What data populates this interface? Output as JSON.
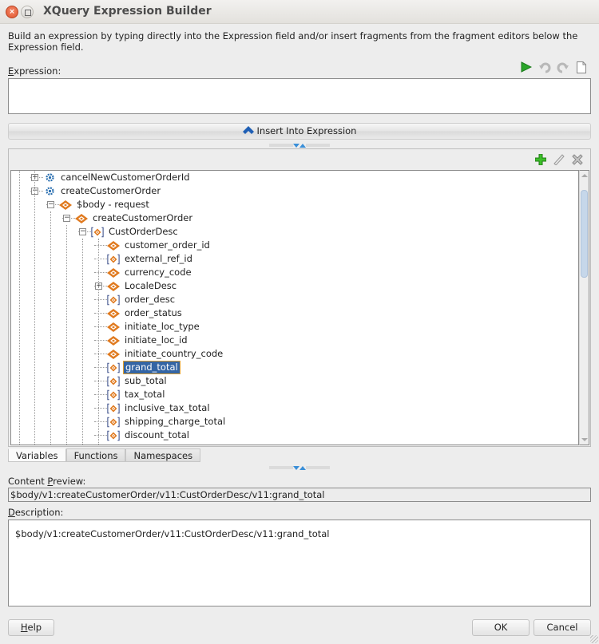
{
  "window": {
    "title": "XQuery Expression Builder"
  },
  "intro_text": "Build an expression by typing directly into the Expression field and/or insert fragments from the fragment editors below the Expression field.",
  "expression": {
    "label_mnemonic": "E",
    "label_rest": "xpression:",
    "value": "",
    "toolbar": [
      {
        "name": "run-icon",
        "color": "#2aa52a"
      },
      {
        "name": "undo-icon"
      },
      {
        "name": "redo-icon"
      },
      {
        "name": "new-document-icon"
      }
    ]
  },
  "insert_button": {
    "label": "Insert Into Expression",
    "icon": "chevron-up-icon",
    "icon_color": "#1f5fb5"
  },
  "tree_toolbar": {
    "add": "add-icon",
    "edit": "edit-icon",
    "delete": "delete-icon"
  },
  "tree": {
    "selected": "grand_total",
    "nodes": [
      {
        "label": "cancelNewCustomerOrderId",
        "icon": "operation-icon",
        "depth": 0,
        "expander": "+"
      },
      {
        "label": "createCustomerOrder",
        "icon": "operation-icon",
        "depth": 0,
        "expander": "-"
      },
      {
        "label": "$body - request",
        "icon": "element-icon",
        "depth": 1,
        "expander": "-"
      },
      {
        "label": "createCustomerOrder",
        "icon": "element-icon",
        "depth": 2,
        "expander": "-"
      },
      {
        "label": "CustOrderDesc",
        "icon": "repeating-element-icon",
        "depth": 3,
        "expander": "-"
      },
      {
        "label": "customer_order_id",
        "icon": "element-icon",
        "depth": 4,
        "expander": ""
      },
      {
        "label": "external_ref_id",
        "icon": "repeating-element-icon",
        "depth": 4,
        "expander": ""
      },
      {
        "label": "currency_code",
        "icon": "element-icon",
        "depth": 4,
        "expander": ""
      },
      {
        "label": "LocaleDesc",
        "icon": "element-icon",
        "depth": 4,
        "expander": "+"
      },
      {
        "label": "order_desc",
        "icon": "repeating-element-icon",
        "depth": 4,
        "expander": ""
      },
      {
        "label": "order_status",
        "icon": "element-icon",
        "depth": 4,
        "expander": ""
      },
      {
        "label": "initiate_loc_type",
        "icon": "element-icon",
        "depth": 4,
        "expander": ""
      },
      {
        "label": "initiate_loc_id",
        "icon": "element-icon",
        "depth": 4,
        "expander": ""
      },
      {
        "label": "initiate_country_code",
        "icon": "element-icon",
        "depth": 4,
        "expander": ""
      },
      {
        "label": "grand_total",
        "icon": "repeating-element-icon",
        "depth": 4,
        "expander": ""
      },
      {
        "label": "sub_total",
        "icon": "repeating-element-icon",
        "depth": 4,
        "expander": ""
      },
      {
        "label": "tax_total",
        "icon": "repeating-element-icon",
        "depth": 4,
        "expander": ""
      },
      {
        "label": "inclusive_tax_total",
        "icon": "repeating-element-icon",
        "depth": 4,
        "expander": ""
      },
      {
        "label": "shipping_charge_total",
        "icon": "repeating-element-icon",
        "depth": 4,
        "expander": ""
      },
      {
        "label": "discount_total",
        "icon": "repeating-element-icon",
        "depth": 4,
        "expander": ""
      }
    ]
  },
  "tabs": [
    {
      "label": "Variables",
      "active": true
    },
    {
      "label": "Functions",
      "active": false
    },
    {
      "label": "Namespaces",
      "active": false
    }
  ],
  "content_preview": {
    "label_before": "Content ",
    "label_mnemonic": "P",
    "label_after": "review:",
    "value": "$body/v1:createCustomerOrder/v11:CustOrderDesc/v11:grand_total"
  },
  "description": {
    "label_mnemonic": "D",
    "label_rest": "escription:",
    "value": "$body/v1:createCustomerOrder/v11:CustOrderDesc/v11:grand_total"
  },
  "buttons": {
    "help_mnemonic": "H",
    "help_rest": "elp",
    "ok": "OK",
    "cancel": "Cancel"
  }
}
